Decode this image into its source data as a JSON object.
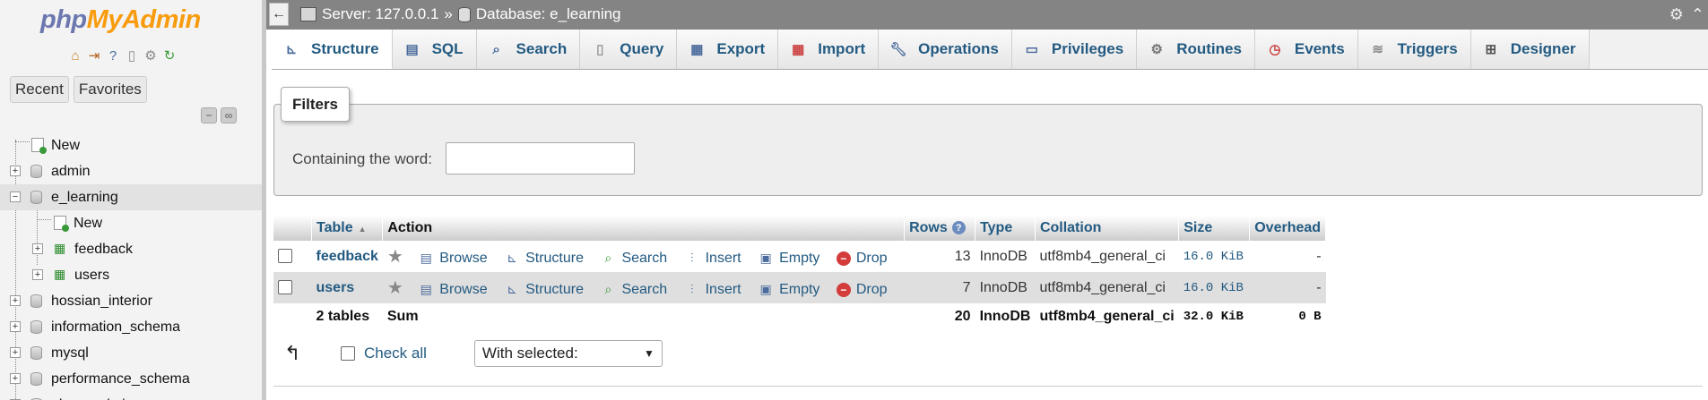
{
  "nav": {
    "logo_php": "php",
    "logo_my": "MyAdmin",
    "recent": "Recent",
    "favorites": "Favorites",
    "tree": {
      "new": "New",
      "admin": "admin",
      "e_learning": "e_learning",
      "e_learning_new": "New",
      "feedback": "feedback",
      "users": "users",
      "hossian_interior": "hossian_interior",
      "information_schema": "information_schema",
      "mysql": "mysql",
      "performance_schema": "performance_schema",
      "phpmyadmin": "phpmyadmin"
    }
  },
  "breadcrumb": {
    "server": "Server: 127.0.0.1",
    "sep": "»",
    "database": "Database: e_learning"
  },
  "tabs": {
    "structure": "Structure",
    "sql": "SQL",
    "search": "Search",
    "query": "Query",
    "export": "Export",
    "import": "Import",
    "operations": "Operations",
    "privileges": "Privileges",
    "routines": "Routines",
    "events": "Events",
    "triggers": "Triggers",
    "designer": "Designer"
  },
  "filters": {
    "legend": "Filters",
    "label": "Containing the word:",
    "value": ""
  },
  "table": {
    "headers": {
      "table": "Table",
      "action": "Action",
      "rows": "Rows",
      "type": "Type",
      "collation": "Collation",
      "size": "Size",
      "overhead": "Overhead"
    },
    "actions": {
      "browse": "Browse",
      "structure": "Structure",
      "search": "Search",
      "insert": "Insert",
      "empty": "Empty",
      "drop": "Drop"
    },
    "rows": [
      {
        "name": "feedback",
        "rows": "13",
        "type": "InnoDB",
        "collation": "utf8mb4_general_ci",
        "size": "16.0 KiB",
        "overhead": "-"
      },
      {
        "name": "users",
        "rows": "7",
        "type": "InnoDB",
        "collation": "utf8mb4_general_ci",
        "size": "16.0 KiB",
        "overhead": "-"
      }
    ],
    "summary": {
      "tables": "2 tables",
      "sum": "Sum",
      "rows": "20",
      "type": "InnoDB",
      "collation": "utf8mb4_general_ci",
      "size": "32.0 KiB",
      "overhead": "0 B"
    }
  },
  "bottom": {
    "check_all": "Check all",
    "with_selected": "With selected:"
  },
  "colors": {
    "link": "#235a81",
    "logo_php": "#6c78af",
    "logo_admin": "#f89c0e",
    "topbar": "#848484"
  }
}
